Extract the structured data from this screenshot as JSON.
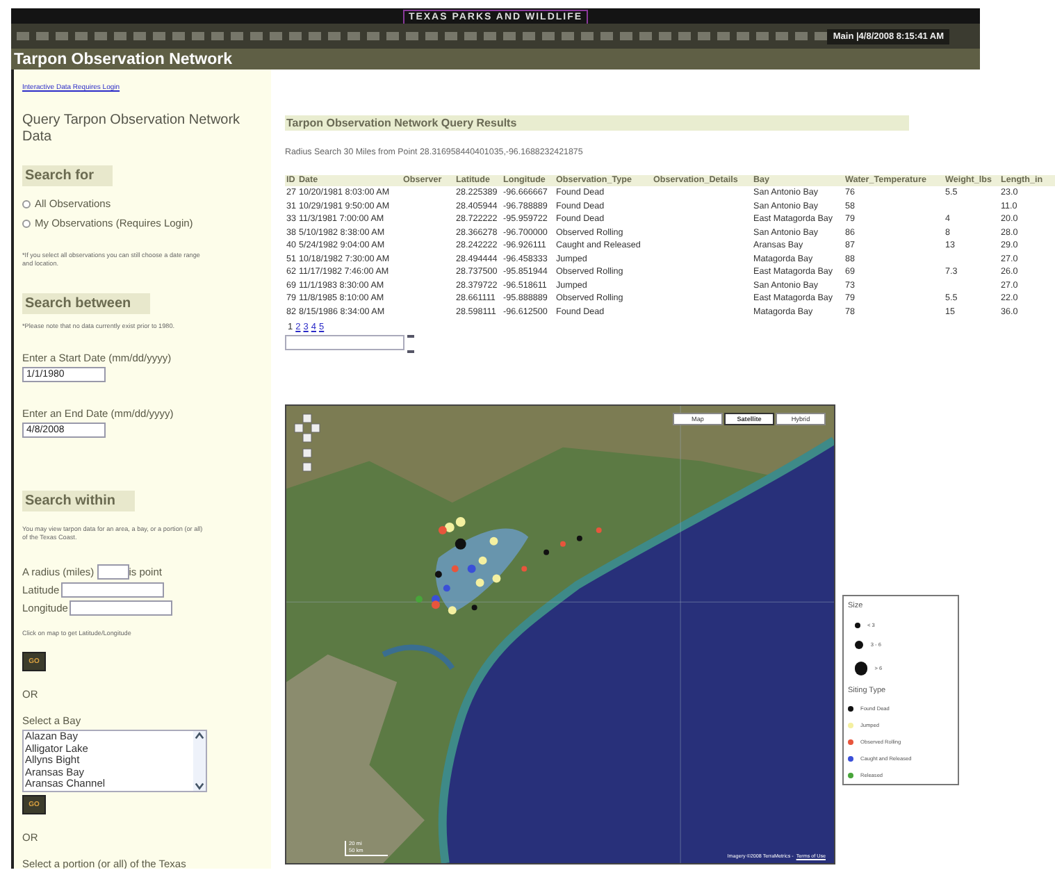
{
  "header": {
    "banner": "TEXAS PARKS AND WILDLIFE",
    "site_title": "Tarpon Observation Network",
    "status": "Main |4/8/2008 8:15:41 AM"
  },
  "sidebar": {
    "login_link": "Interactive Data Requires Login",
    "heading": "Query Tarpon Observation Network Data",
    "search_for": {
      "title": "Search for",
      "options": [
        {
          "label": "All Observations",
          "selected": false
        },
        {
          "label": "My Observations (Requires Login)",
          "selected": false
        }
      ],
      "note": "*If you select all observations you can still choose a date range and location."
    },
    "search_between": {
      "title": "Search between",
      "note": "*Please note that no data currently exist prior to 1980.",
      "start_date": {
        "label": "Enter a Start Date (mm/dd/yyyy)",
        "value": "1/1/1980"
      },
      "end_date": {
        "label": "Enter an End Date (mm/dd/yyyy)",
        "value": "4/8/2008"
      }
    },
    "search_within": {
      "title": "Search within",
      "note": "You may view tarpon data for an area, a bay, or a portion (or all) of the Texas Coast.",
      "radius_label": "A radius (miles)",
      "radius_suffix": "is point",
      "latitude_label": "Latitude",
      "longitude_label": "Longitude",
      "map_hint": "Click on map to get Latitude/Longitude",
      "go_button": "GO",
      "or_1": "OR",
      "bay_label": "Select a Bay",
      "bays": [
        "Alazan Bay",
        "Alligator Lake",
        "Allyns Bight",
        "Aransas Bay",
        "Aransas Channel"
      ],
      "go_button_2": "GO",
      "or_2": "OR",
      "portion_label": "Select a portion (or all) of the Texas"
    }
  },
  "results": {
    "title": "Tarpon Observation Network Query Results",
    "summary": "Radius Search 30 Miles from Point 28.316958440401035,-96.1688232421875",
    "columns": [
      "ID",
      "Date",
      "Observer",
      "Latitude",
      "Longitude",
      "Observation_Type",
      "Observation_Details",
      "Bay",
      "Water_Temperature",
      "Weight_lbs",
      "Length_in"
    ],
    "rows": [
      [
        "27",
        "10/20/1981 8:03:00 AM",
        null,
        "28.225389",
        "-96.666667",
        "Found Dead",
        null,
        "San Antonio Bay",
        "76",
        "5.5",
        "23.0"
      ],
      [
        "31",
        "10/29/1981 9:50:00 AM",
        null,
        "28.405944",
        "-96.788889",
        "Found Dead",
        null,
        "San Antonio Bay",
        "58",
        null,
        "11.0"
      ],
      [
        "33",
        "11/3/1981 7:00:00 AM",
        null,
        "28.722222",
        "-95.959722",
        "Found Dead",
        null,
        "East Matagorda Bay",
        "79",
        "4",
        "20.0"
      ],
      [
        "38",
        "5/10/1982 8:38:00 AM",
        null,
        "28.366278",
        "-96.700000",
        "Observed Rolling",
        null,
        "San Antonio Bay",
        "86",
        "8",
        "28.0"
      ],
      [
        "40",
        "5/24/1982 9:04:00 AM",
        null,
        "28.242222",
        "-96.926111",
        "Caught and Released",
        null,
        "Aransas Bay",
        "87",
        "13",
        "29.0"
      ],
      [
        "51",
        "10/18/1982 7:30:00 AM",
        null,
        "28.494444",
        "-96.458333",
        "Jumped",
        null,
        "Matagorda Bay",
        "88",
        null,
        "27.0"
      ],
      [
        "62",
        "11/17/1982 7:46:00 AM",
        null,
        "28.737500",
        "-95.851944",
        "Observed Rolling",
        null,
        "East Matagorda Bay",
        "69",
        "7.3",
        "26.0"
      ],
      [
        "69",
        "11/1/1983 8:30:00 AM",
        null,
        "28.379722",
        "-96.518611",
        "Jumped",
        null,
        "San Antonio Bay",
        "73",
        null,
        "27.0"
      ],
      [
        "79",
        "11/8/1985 8:10:00 AM",
        null,
        "28.661111",
        "-95.888889",
        "Observed Rolling",
        null,
        "East Matagorda Bay",
        "79",
        "5.5",
        "22.0"
      ],
      [
        "82",
        "8/15/1986 8:34:00 AM",
        null,
        "28.598111",
        "-96.612500",
        "Found Dead",
        null,
        "Matagorda Bay",
        "78",
        "15",
        "36.0"
      ]
    ],
    "pages": [
      {
        "label": "1",
        "selected": true
      },
      {
        "label": "2",
        "selected": false
      },
      {
        "label": "3",
        "selected": false
      },
      {
        "label": "4",
        "selected": false
      },
      {
        "label": "5",
        "selected": false
      }
    ]
  },
  "map": {
    "map_types": [
      {
        "label": "Map",
        "selected": false
      },
      {
        "label": "Satellite",
        "selected": true
      },
      {
        "label": "Hybrid",
        "selected": false
      }
    ],
    "scale": [
      "20 mi",
      "50 km"
    ],
    "attribution": "Imagery ©2008 TerraMetrics -",
    "terms_link": "Terms of Use"
  },
  "legend": {
    "size_title": "Size",
    "sizes": [
      "< 3",
      "3 - 6",
      "> 6"
    ],
    "type_title": "Siting Type",
    "types": [
      {
        "label": "Found Dead",
        "color": "#111111"
      },
      {
        "label": "Jumped",
        "color": "#f4f0a0"
      },
      {
        "label": "Observed Rolling",
        "color": "#e8553c"
      },
      {
        "label": "Caught and Released",
        "color": "#3a4fd8"
      },
      {
        "label": "Released",
        "color": "#48a53a"
      }
    ]
  }
}
